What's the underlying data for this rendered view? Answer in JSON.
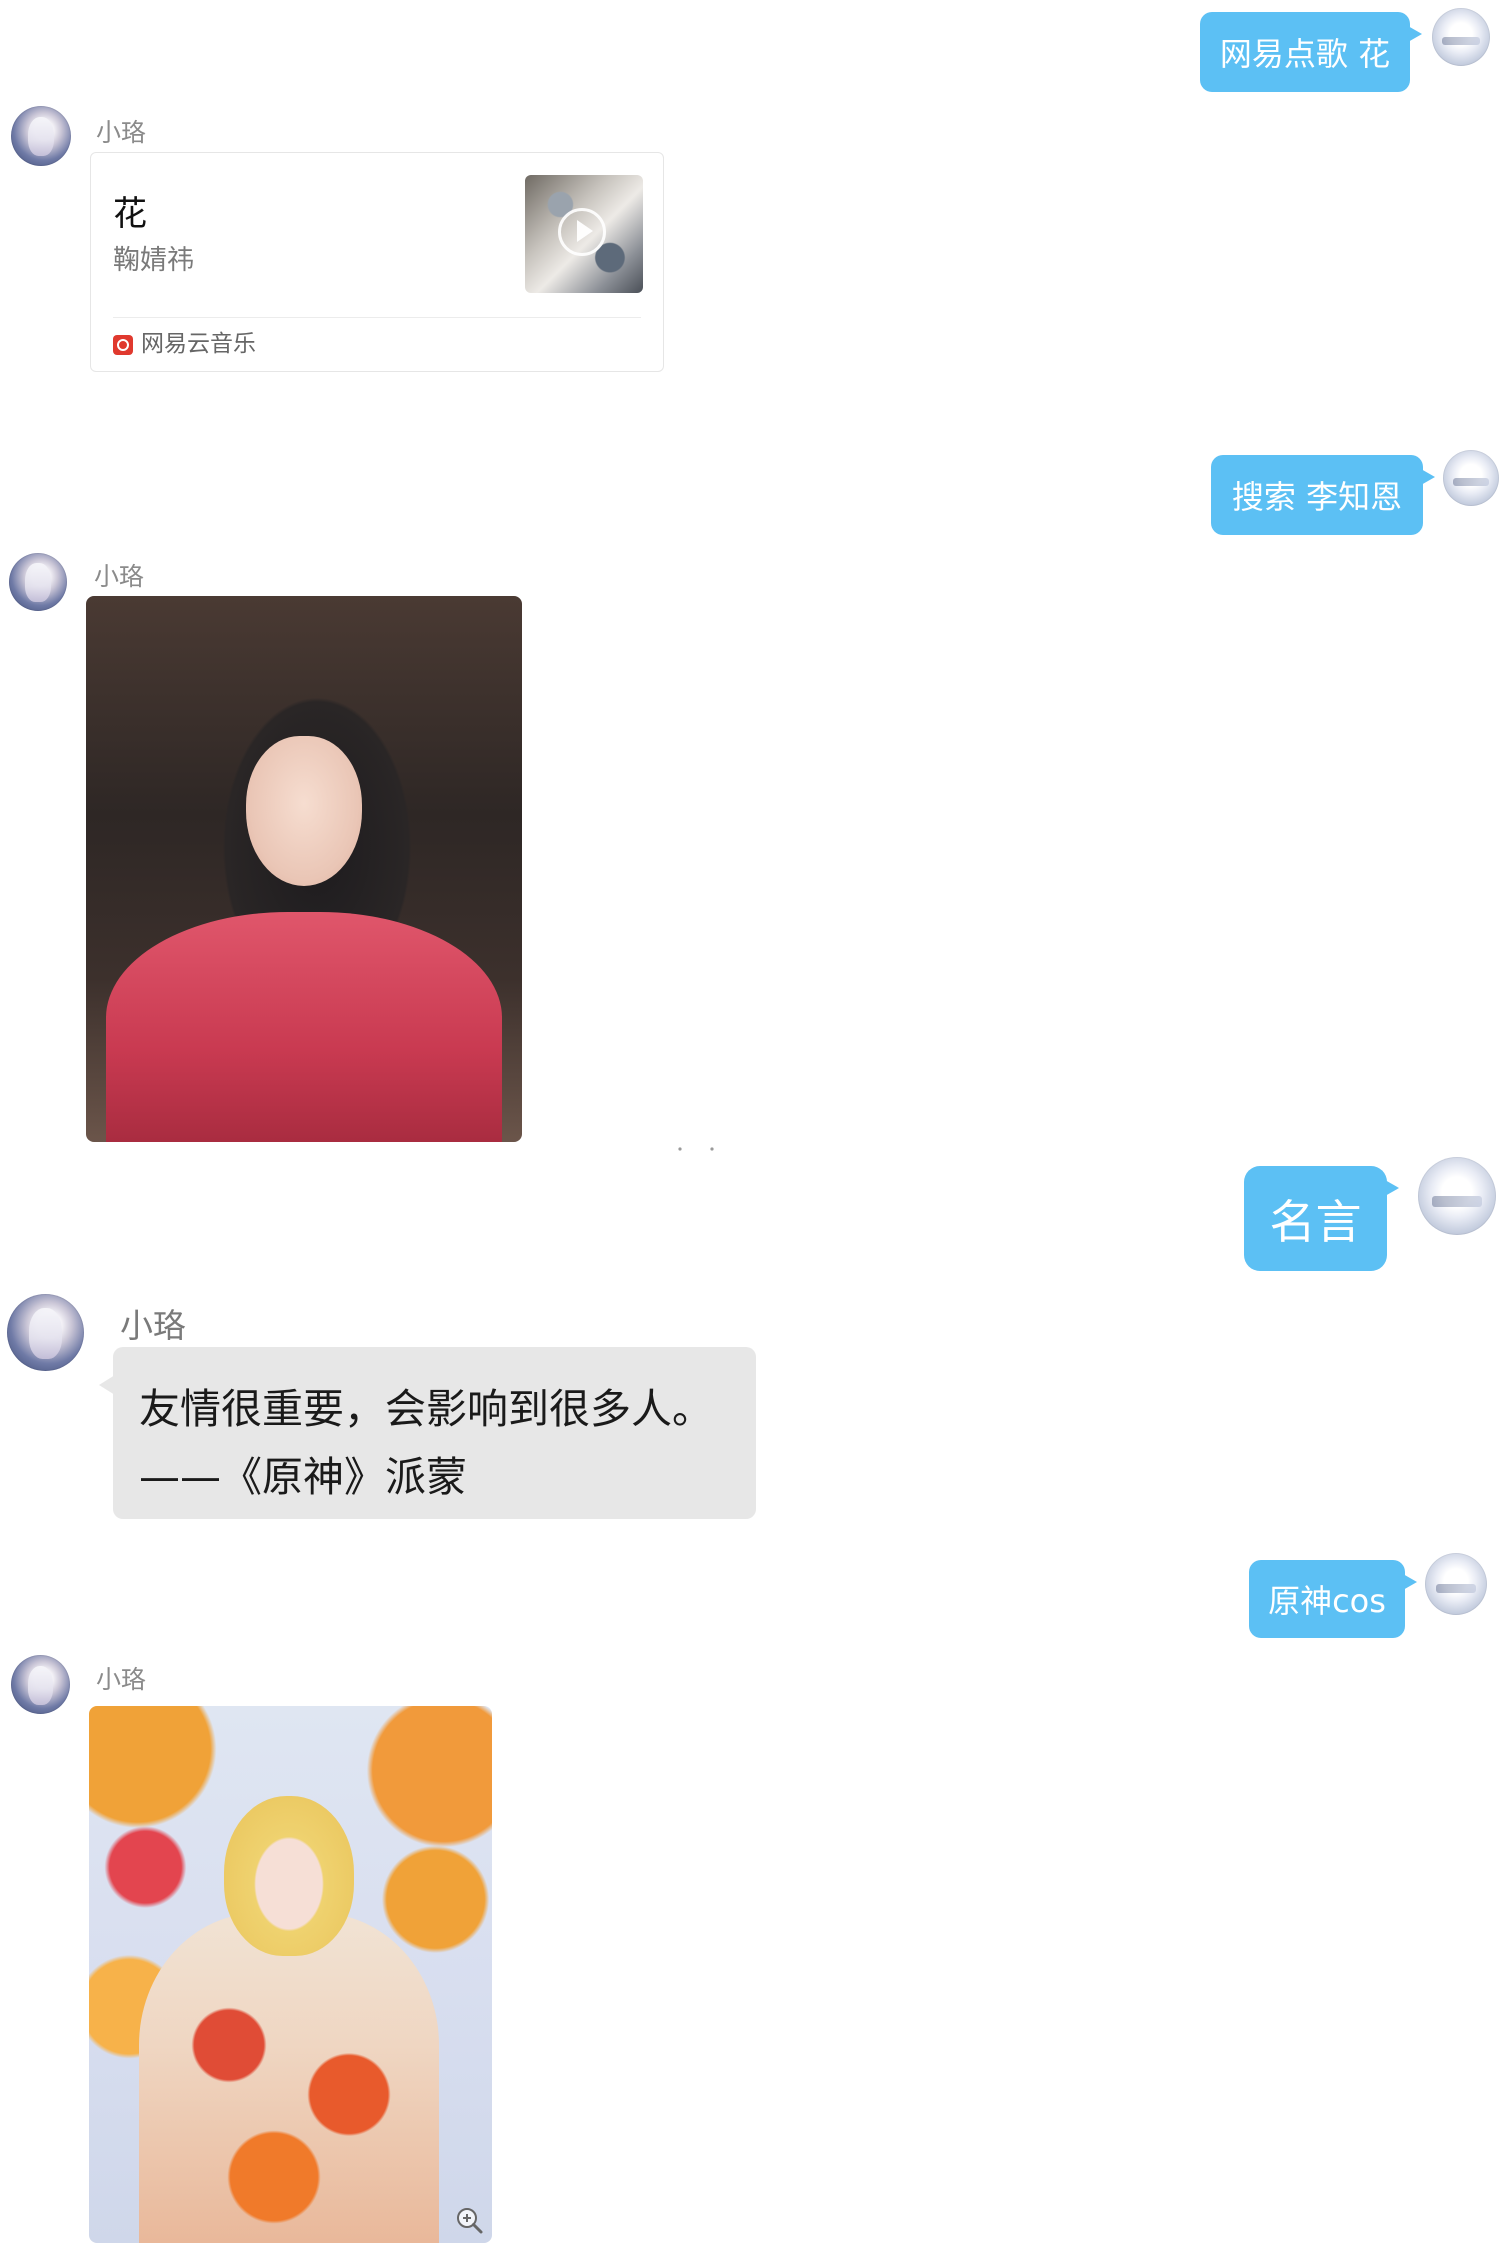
{
  "messages": {
    "m1": {
      "text": "网易点歌 花"
    },
    "m2": {
      "sender": "小珞",
      "card": {
        "title": "花",
        "artist": "鞠婧祎",
        "source": "网易云音乐"
      }
    },
    "m3": {
      "text": "搜索 李知恩"
    },
    "m4": {
      "sender": "小珞"
    },
    "m5": {
      "text": "名言"
    },
    "m6": {
      "sender": "小珞",
      "lines": [
        "友情很重要，会影响到很多人。",
        "——《原神》派蒙"
      ]
    },
    "m7": {
      "text": "原神cos"
    },
    "m8": {
      "sender": "小珞"
    }
  },
  "icons": {
    "music_source": "netease-cloud-music-icon",
    "play": "play-icon",
    "zoom": "zoom-in-icon"
  },
  "colors": {
    "outgoing_bubble": "#5cc0f4",
    "incoming_bubble": "#e7e7e7",
    "sender_name": "#8b8b8b",
    "netease_red": "#e0392e"
  }
}
